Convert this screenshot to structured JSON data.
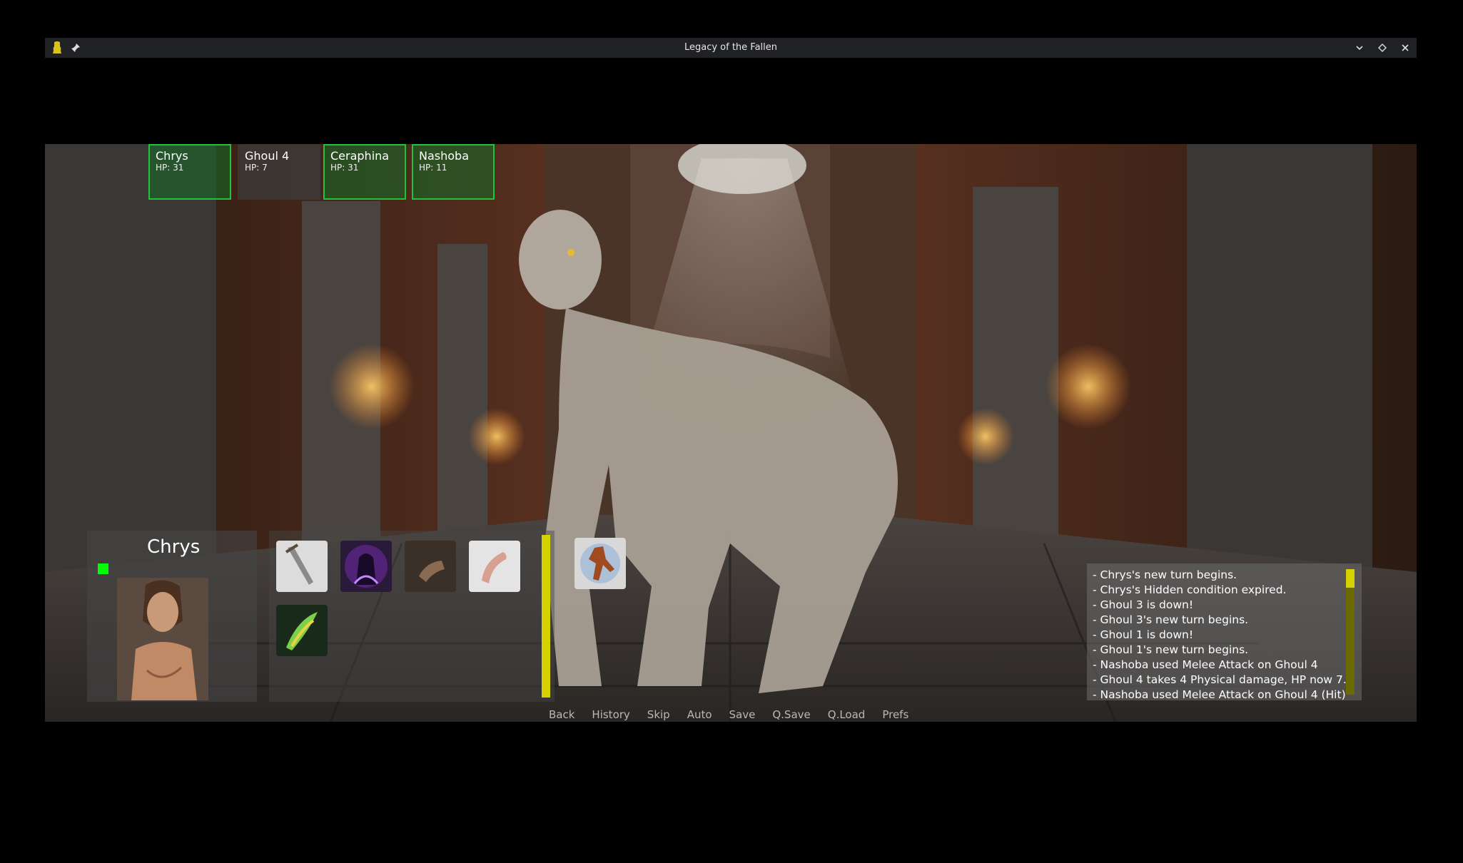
{
  "window": {
    "title": "Legacy of the Fallen",
    "controls": [
      "minimize",
      "maximize",
      "close"
    ]
  },
  "party": [
    {
      "name": "Chrys",
      "hp": "HP: 31",
      "side": "ally"
    },
    {
      "name": "Ghoul 4",
      "hp": "HP: 7",
      "side": "enemy"
    },
    {
      "name": "Ceraphina",
      "hp": "HP: 31",
      "side": "ally"
    },
    {
      "name": "Nashoba",
      "hp": "HP: 11",
      "side": "ally"
    }
  ],
  "active_character": {
    "name": "Chrys"
  },
  "skills": [
    {
      "icon": "dagger-icon"
    },
    {
      "icon": "shadow-cloak-icon"
    },
    {
      "icon": "grab-hand-icon"
    },
    {
      "icon": "horn-icon"
    },
    {
      "icon": "green-flame-blade-icon"
    }
  ],
  "actor_icon": "acrobat-actor-icon",
  "combat_log": [
    "- Chrys's new turn begins.",
    "- Chrys's Hidden condition expired.",
    "- Ghoul 3 is down!",
    "- Ghoul 3's new turn begins.",
    "- Ghoul 1 is down!",
    "- Ghoul 1's new turn begins.",
    "- Nashoba used Melee Attack on Ghoul 4",
    "- Ghoul 4 takes 4 Physical damage, HP now 7.",
    "- Nashoba used Melee Attack on Ghoul 4 (Hit)"
  ],
  "quick_menu": [
    "Back",
    "History",
    "Skip",
    "Auto",
    "Save",
    "Q.Save",
    "Q.Load",
    "Prefs"
  ],
  "colors": {
    "ally_border": "#22c33c",
    "turn_indicator": "#00ff00",
    "accent_bar": "#d6d100"
  }
}
